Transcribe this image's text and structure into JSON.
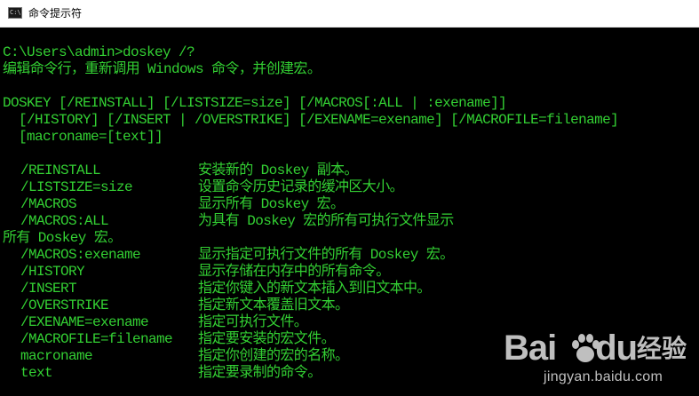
{
  "window": {
    "title": "命令提示符",
    "icon": "cmd-icon",
    "icon_glyph": "C:\\"
  },
  "console": {
    "prompt_line": "C:\\Users\\admin>doskey /?",
    "description": "编辑命令行，重新调用 Windows 命令，并创建宏。",
    "syntax": [
      "DOSKEY [/REINSTALL] [/LISTSIZE=size] [/MACROS[:ALL | :exename]]",
      "  [/HISTORY] [/INSERT | /OVERSTRIKE] [/EXENAME=exename] [/MACROFILE=filename]",
      "  [macroname=[text]]"
    ],
    "options_a": [
      {
        "key": "/REINSTALL",
        "desc": "安装新的 Doskey 副本。"
      },
      {
        "key": "/LISTSIZE=size",
        "desc": "设置命令历史记录的缓冲区大小。"
      },
      {
        "key": "/MACROS",
        "desc": "显示所有 Doskey 宏。"
      },
      {
        "key": "/MACROS:ALL",
        "desc": "为具有 Doskey 宏的所有可执行文件显示"
      }
    ],
    "wrap_line": "所有 Doskey 宏。",
    "options_b": [
      {
        "key": "/MACROS:exename",
        "desc": "显示指定可执行文件的所有 Doskey 宏。"
      },
      {
        "key": "/HISTORY",
        "desc": "显示存储在内存中的所有命令。"
      },
      {
        "key": "/INSERT",
        "desc": "指定你键入的新文本插入到旧文本中。"
      },
      {
        "key": "/OVERSTRIKE",
        "desc": "指定新文本覆盖旧文本。"
      },
      {
        "key": "/EXENAME=exename",
        "desc": "指定可执行文件。"
      },
      {
        "key": "/MACROFILE=filename",
        "desc": "指定要安装的宏文件。"
      },
      {
        "key": "macroname",
        "desc": "指定你创建的宏的名称。"
      },
      {
        "key": "text",
        "desc": "指定要录制的命令。"
      }
    ]
  },
  "watermark": {
    "logo": "Bai",
    "logo_suffix": "du",
    "brand_cn": "经验",
    "url": "jingyan.baidu.com",
    "paw_icon": "baidu-paw-icon"
  },
  "colors": {
    "console_text": "#33d033",
    "console_bg": "#000000",
    "titlebar_bg": "#ffffff"
  }
}
